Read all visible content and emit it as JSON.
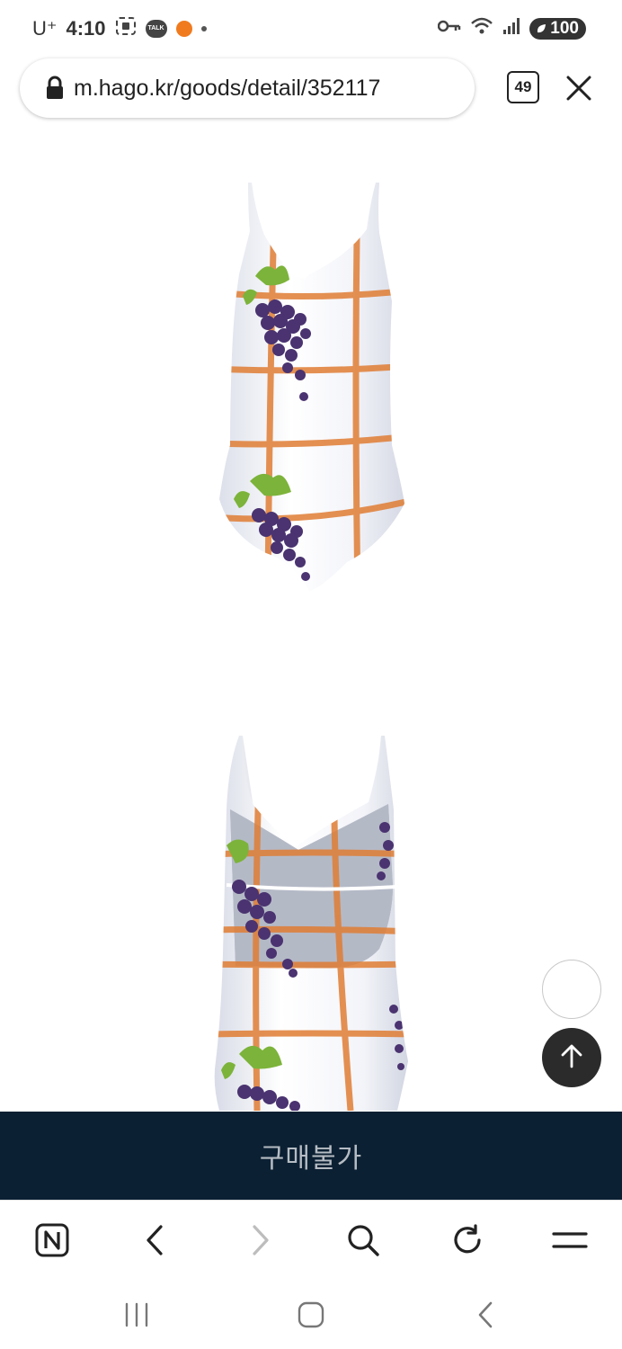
{
  "status_bar": {
    "carrier": "U⁺",
    "time": "4:10",
    "talk_badge": "TALK",
    "battery": "100",
    "icons": [
      "screenshot-icon",
      "kakaotalk-icon",
      "orange-app-icon",
      "notification-dot-icon",
      "key-icon",
      "wifi-icon",
      "signal-icon",
      "battery-icon"
    ]
  },
  "browser": {
    "url": "m.hago.kr/goods/detail/352117",
    "tab_count": "49"
  },
  "product": {
    "images": [
      "swimsuit-front-image",
      "swimsuit-back-image"
    ]
  },
  "purchase": {
    "label": "구매불가"
  },
  "toolbar": {
    "icons": [
      "naver-home-icon",
      "back-icon",
      "forward-icon",
      "search-icon",
      "refresh-icon",
      "menu-icon"
    ]
  },
  "system_nav": {
    "icons": [
      "recent-apps-icon",
      "home-icon",
      "back-icon"
    ]
  },
  "colors": {
    "purchase_bar": "#0b2033",
    "purchase_text": "#b6bcc3",
    "plaid": "#e07d34",
    "grape": "#4a3370",
    "leaf": "#7cb33a"
  }
}
